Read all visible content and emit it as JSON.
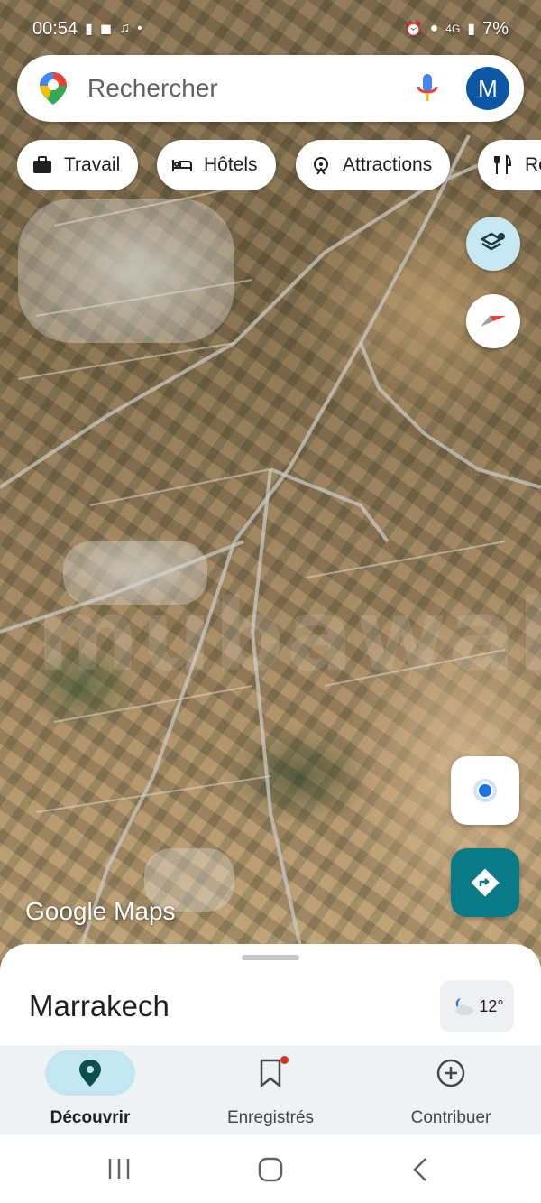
{
  "status_bar": {
    "time": "00:54",
    "network": "4G",
    "battery": "7%"
  },
  "search": {
    "placeholder": "Rechercher",
    "avatar_initial": "M"
  },
  "chips": [
    {
      "label": "Travail",
      "icon": "briefcase-icon"
    },
    {
      "label": "Hôtels",
      "icon": "bed-icon"
    },
    {
      "label": "Attractions",
      "icon": "attractions-icon"
    },
    {
      "label": "Re",
      "icon": "restaurant-icon"
    }
  ],
  "map": {
    "watermark": "mubawab",
    "attribution": "Google Maps"
  },
  "sheet": {
    "place_name": "Marrakech",
    "temperature": "12°",
    "weather_icon": "moon-cloud-icon"
  },
  "bottom_nav": {
    "items": [
      {
        "label": "Découvrir",
        "icon": "location-pin-icon",
        "active": true
      },
      {
        "label": "Enregistrés",
        "icon": "bookmark-icon",
        "active": false
      },
      {
        "label": "Contribuer",
        "icon": "add-circle-icon",
        "active": false
      }
    ]
  },
  "colors": {
    "accent": "#0a7a86",
    "avatar_bg": "#0b57a4",
    "active_nav_bg": "#c3e7f2"
  }
}
